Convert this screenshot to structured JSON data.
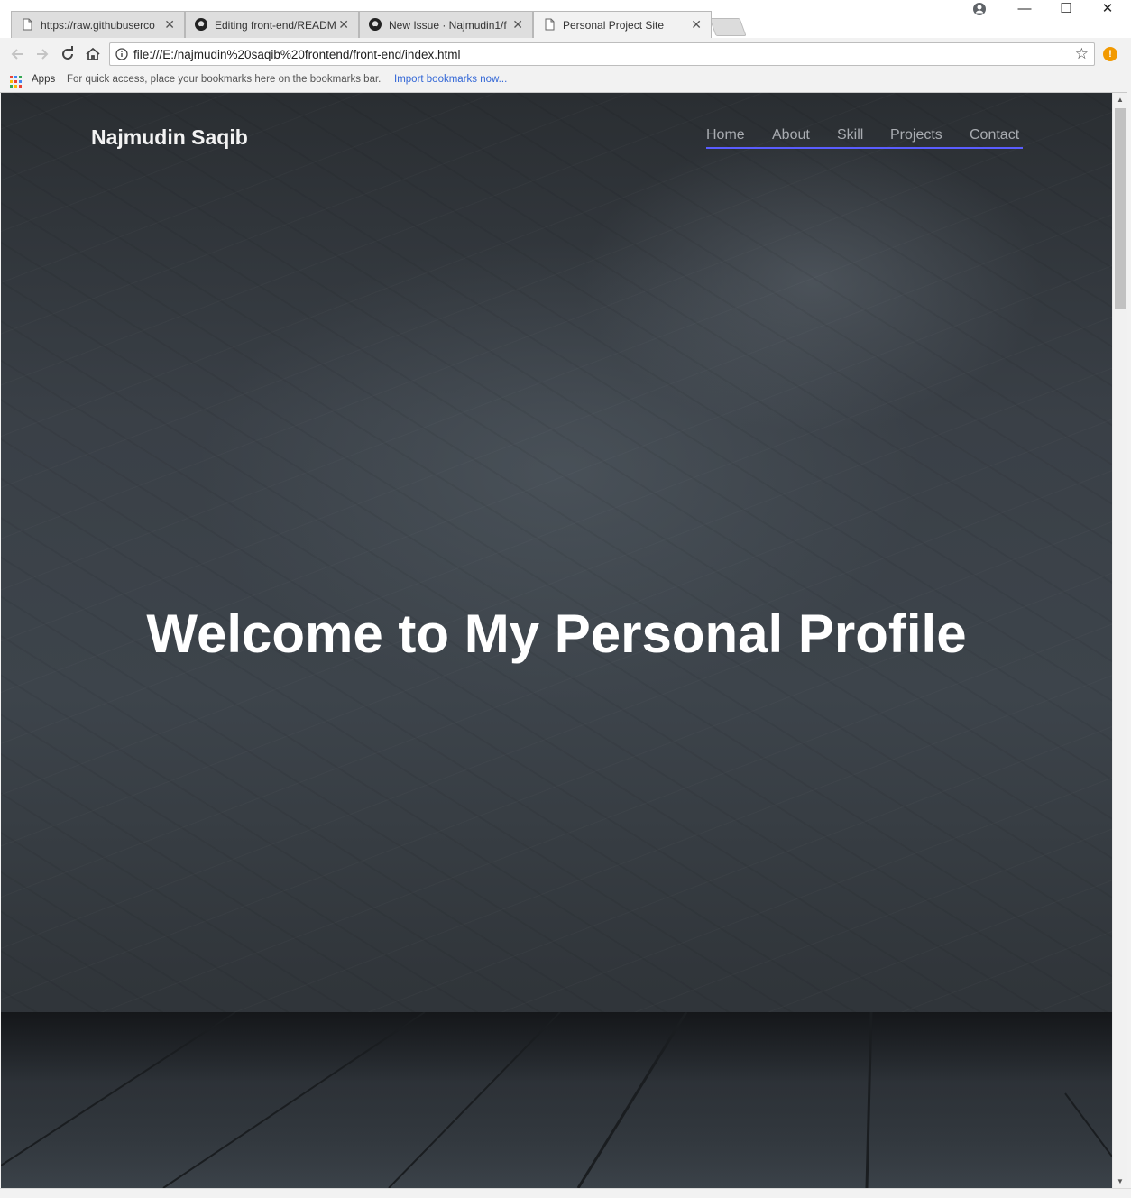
{
  "browser": {
    "tabs": [
      {
        "title": "https://raw.githubuserco",
        "icon": "page-icon",
        "active": false
      },
      {
        "title": "Editing front-end/READM",
        "icon": "github-icon",
        "active": false
      },
      {
        "title": "New Issue · Najmudin1/f",
        "icon": "github-icon",
        "active": false
      },
      {
        "title": "Personal Project Site",
        "icon": "page-icon",
        "active": true
      }
    ],
    "tab_close_glyph": "✕",
    "window_buttons": {
      "minimize": "—",
      "maximize": "☐",
      "close": "✕"
    },
    "url": "file:///E:/najmudin%20saqib%20frontend/front-end/index.html",
    "bookmarks": {
      "apps_label": "Apps",
      "hint": "For quick access, place your bookmarks here on the bookmarks bar.",
      "import_link": "Import bookmarks now..."
    }
  },
  "site": {
    "brand": "Najmudin Saqib",
    "nav": [
      "Home",
      "About",
      "Skill",
      "Projects",
      "Contact"
    ],
    "hero_title": "Welcome to My Personal Profile"
  },
  "colors": {
    "nav_underline": "#5a5dff",
    "nav_text": "#a9acb1",
    "hero_text": "#ffffff",
    "alert": "#f29900"
  }
}
